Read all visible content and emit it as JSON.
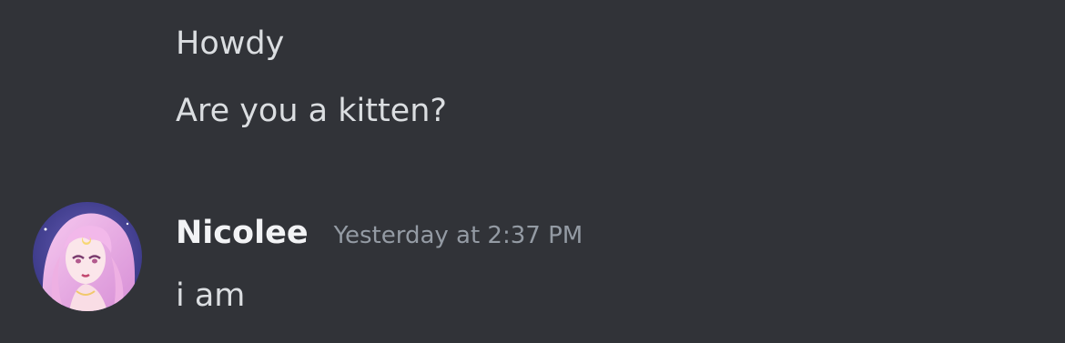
{
  "messages": {
    "earlier": [
      {
        "content": "Howdy"
      },
      {
        "content": "Are you a kitten?"
      }
    ],
    "latest": {
      "author": "Nicolee",
      "timestamp": "Yesterday at 2:37 PM",
      "content": "i am"
    }
  },
  "avatar": {
    "icon": "user-avatar-pink-hair-illustration"
  },
  "colors": {
    "background": "#313338",
    "message_text": "#dbdee1",
    "username": "#f2f3f5",
    "timestamp": "#949ba4"
  }
}
